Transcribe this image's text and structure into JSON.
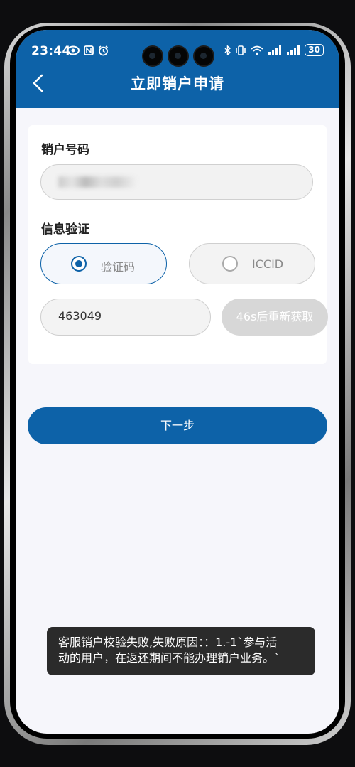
{
  "status_bar": {
    "time": "23:44",
    "battery": "30"
  },
  "header": {
    "title": "立即销户申请"
  },
  "form": {
    "account_label": "销户号码",
    "account_value_masked": "",
    "verify_label": "信息验证",
    "options": [
      {
        "label": "验证码",
        "selected": true
      },
      {
        "label": "ICCID",
        "selected": false
      }
    ],
    "code_value": "463049",
    "resend_label": "46s后重新获取"
  },
  "next_button": "下一步",
  "toast": {
    "line1": "客服销户校验失败,失败原因：：1.-1`参与活",
    "line2": "动的用户，在返还期间不能办理销户业务。`"
  },
  "colors": {
    "brand": "#0d62a8",
    "disabled": "#d7d7d7"
  }
}
